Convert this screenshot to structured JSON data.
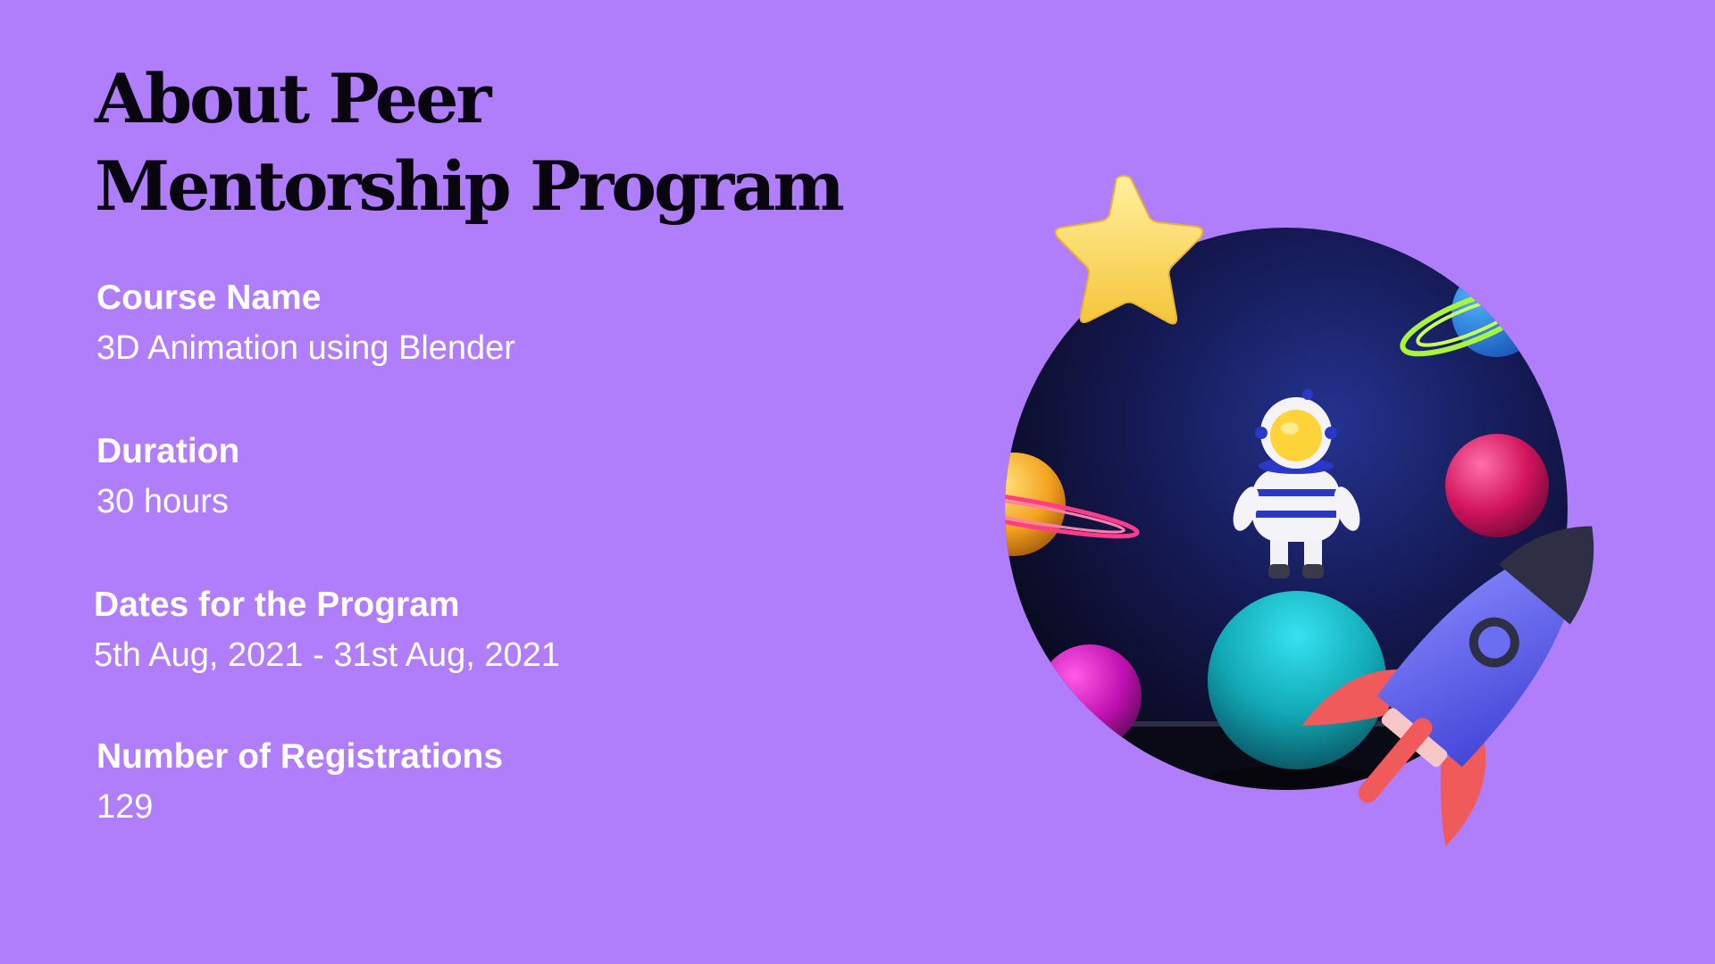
{
  "title": {
    "line1": "About Peer",
    "line2": "Mentorship Program"
  },
  "details": [
    {
      "label": "Course Name",
      "value": "3D Animation using Blender"
    },
    {
      "label": "Duration",
      "value": "30 hours"
    },
    {
      "label": "Dates for the Program",
      "value": "5th Aug, 2021 - 31st Aug, 2021"
    },
    {
      "label": "Number of Registrations",
      "value": "129"
    }
  ],
  "colors": {
    "background": "#b07dfb",
    "title": "#0a0610",
    "text": "#ffffff"
  },
  "illustration": {
    "icons": [
      "star-icon",
      "astronaut-icon",
      "planet-icon",
      "rocket-icon"
    ]
  }
}
